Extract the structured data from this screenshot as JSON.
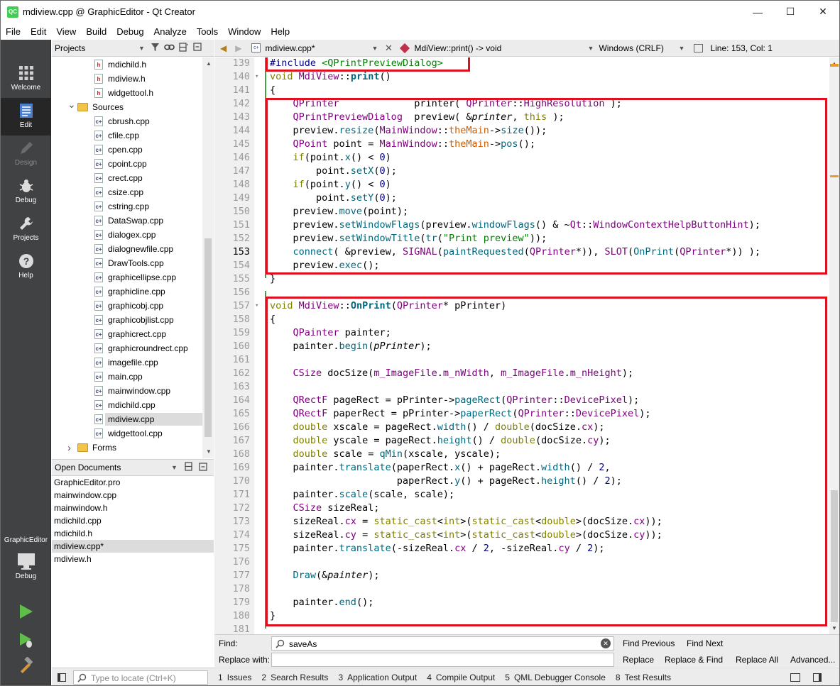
{
  "window": {
    "title": "mdiview.cpp @ GraphicEditor - Qt Creator",
    "logo": "QC",
    "minimize": "—",
    "maximize": "☐",
    "close": "✕"
  },
  "menu": [
    "File",
    "Edit",
    "View",
    "Build",
    "Debug",
    "Analyze",
    "Tools",
    "Window",
    "Help"
  ],
  "modes": [
    {
      "label": "Welcome",
      "icon": "grid-icon"
    },
    {
      "label": "Edit",
      "icon": "edit-icon"
    },
    {
      "label": "Design",
      "icon": "pencil-icon"
    },
    {
      "label": "Debug",
      "icon": "bug-icon"
    },
    {
      "label": "Projects",
      "icon": "wrench-icon"
    },
    {
      "label": "Help",
      "icon": "help-icon"
    }
  ],
  "kit": {
    "project": "GraphicEditor",
    "mode": "Debug"
  },
  "projects_pane": {
    "title": "Projects"
  },
  "tree": [
    {
      "label": "mdichild.h",
      "type": "h"
    },
    {
      "label": "mdiview.h",
      "type": "h"
    },
    {
      "label": "widgettool.h",
      "type": "h"
    },
    {
      "label": "Sources",
      "type": "folder",
      "expanded": true
    },
    {
      "label": "cbrush.cpp",
      "type": "cpp"
    },
    {
      "label": "cfile.cpp",
      "type": "cpp"
    },
    {
      "label": "cpen.cpp",
      "type": "cpp"
    },
    {
      "label": "cpoint.cpp",
      "type": "cpp"
    },
    {
      "label": "crect.cpp",
      "type": "cpp"
    },
    {
      "label": "csize.cpp",
      "type": "cpp"
    },
    {
      "label": "cstring.cpp",
      "type": "cpp"
    },
    {
      "label": "DataSwap.cpp",
      "type": "cpp"
    },
    {
      "label": "dialogex.cpp",
      "type": "cpp"
    },
    {
      "label": "dialognewfile.cpp",
      "type": "cpp"
    },
    {
      "label": "DrawTools.cpp",
      "type": "cpp"
    },
    {
      "label": "graphicellipse.cpp",
      "type": "cpp"
    },
    {
      "label": "graphicline.cpp",
      "type": "cpp"
    },
    {
      "label": "graphicobj.cpp",
      "type": "cpp"
    },
    {
      "label": "graphicobjlist.cpp",
      "type": "cpp"
    },
    {
      "label": "graphicrect.cpp",
      "type": "cpp"
    },
    {
      "label": "graphicroundrect.cpp",
      "type": "cpp"
    },
    {
      "label": "imagefile.cpp",
      "type": "cpp"
    },
    {
      "label": "main.cpp",
      "type": "cpp"
    },
    {
      "label": "mainwindow.cpp",
      "type": "cpp"
    },
    {
      "label": "mdichild.cpp",
      "type": "cpp"
    },
    {
      "label": "mdiview.cpp",
      "type": "cpp",
      "selected": true
    },
    {
      "label": "widgettool.cpp",
      "type": "cpp"
    },
    {
      "label": "Forms",
      "type": "folder",
      "expanded": false
    }
  ],
  "open_documents": {
    "title": "Open Documents",
    "items": [
      "GraphicEditor.pro",
      "mainwindow.cpp",
      "mainwindow.h",
      "mdichild.cpp",
      "mdichild.h",
      "mdiview.cpp*",
      "mdiview.h"
    ],
    "selected": "mdiview.cpp*"
  },
  "editor_toolbar": {
    "file": "mdiview.cpp*",
    "symbol": "MdiView::print() -> void",
    "line_ending": "Windows (CRLF)",
    "position": "Line: 153, Col: 1"
  },
  "code": {
    "current_line": 153,
    "lines": [
      {
        "n": 139,
        "html": "<span class=\"pp\">#include</span> <span class=\"st\">&lt;QPrintPreviewDialog&gt;</span>"
      },
      {
        "n": 140,
        "fold": true,
        "html": "<span class=\"kw\">void</span> <span class=\"ty\">MdiView</span>::<span class=\"fn\" style=\"font-weight:bold\">print</span>()"
      },
      {
        "n": 141,
        "html": "{"
      },
      {
        "n": 142,
        "html": "    <span class=\"ty\">QPrinter</span>             printer( <span class=\"ty\">QPrinter</span>::<span class=\"ty\">HighResolution</span> );"
      },
      {
        "n": 143,
        "html": "    <span class=\"ty\">QPrintPreviewDialog</span>  preview( &amp;<span class=\"it\">printer</span>, <span class=\"kw\">this</span> );"
      },
      {
        "n": 144,
        "html": "    preview.<span class=\"fn\">resize</span>(<span class=\"ty\">MainWindow</span>::<span class=\"mb\">theMain</span>-&gt;<span class=\"fn\">size</span>());"
      },
      {
        "n": 145,
        "html": "    <span class=\"ty\">QPoint</span> point = <span class=\"ty\">MainWindow</span>::<span class=\"mb\">theMain</span>-&gt;<span class=\"fn\">pos</span>();"
      },
      {
        "n": 146,
        "html": "    <span class=\"kw\">if</span>(point.<span class=\"fn\">x</span>() &lt; <span class=\"num\">0</span>)"
      },
      {
        "n": 147,
        "html": "        point.<span class=\"fn\">setX</span>(<span class=\"num\">0</span>);"
      },
      {
        "n": 148,
        "html": "    <span class=\"kw\">if</span>(point.<span class=\"fn\">y</span>() &lt; <span class=\"num\">0</span>)"
      },
      {
        "n": 149,
        "html": "        point.<span class=\"fn\">setY</span>(<span class=\"num\">0</span>);"
      },
      {
        "n": 150,
        "html": "    preview.<span class=\"fn\">move</span>(point);"
      },
      {
        "n": 151,
        "html": "    preview.<span class=\"fn\">setWindowFlags</span>(preview.<span class=\"fn\">windowFlags</span>() &amp; ~<span class=\"ty\">Qt</span>::<span class=\"ty\">WindowContextHelpButtonHint</span>);"
      },
      {
        "n": 152,
        "html": "    preview.<span class=\"fn\">setWindowTitle</span>(<span class=\"fn\">tr</span>(<span class=\"st\">\"Print preview\"</span>));"
      },
      {
        "n": 153,
        "html": "    <span class=\"fn\">connect</span>( &amp;preview, <span class=\"ty\">SIGNAL</span>(<span class=\"fn\">paintRequested</span>(<span class=\"ty\">QPrinter</span>*)), <span class=\"ty\">SLOT</span>(<span class=\"fn\">OnPrint</span>(<span class=\"ty\">QPrinter</span>*)) );"
      },
      {
        "n": 154,
        "html": "    preview.<span class=\"fn\">exec</span>();"
      },
      {
        "n": 155,
        "html": "}"
      },
      {
        "n": 156,
        "html": ""
      },
      {
        "n": 157,
        "fold": true,
        "html": "<span class=\"kw\">void</span> <span class=\"ty\">MdiView</span>::<span class=\"fn\" style=\"font-weight:bold\">OnPrint</span>(<span class=\"ty\">QPrinter</span>* pPrinter)"
      },
      {
        "n": 158,
        "html": "{"
      },
      {
        "n": 159,
        "html": "    <span class=\"ty\">QPainter</span> painter;"
      },
      {
        "n": 160,
        "html": "    painter.<span class=\"fn\">begin</span>(<span class=\"it\">pPrinter</span>);"
      },
      {
        "n": 161,
        "html": ""
      },
      {
        "n": 162,
        "html": "    <span class=\"ty\">CSize</span> docSize(<span class=\"ty\">m_ImageFile</span>.<span class=\"ty\">m_nWidth</span>, <span class=\"ty\">m_ImageFile</span>.<span class=\"ty\">m_nHeight</span>);"
      },
      {
        "n": 163,
        "html": ""
      },
      {
        "n": 164,
        "html": "    <span class=\"ty\">QRectF</span> pageRect = pPrinter-&gt;<span class=\"fn\">pageRect</span>(<span class=\"ty\">QPrinter</span>::<span class=\"ty\">DevicePixel</span>);"
      },
      {
        "n": 165,
        "html": "    <span class=\"ty\">QRectF</span> paperRect = pPrinter-&gt;<span class=\"fn\">paperRect</span>(<span class=\"ty\">QPrinter</span>::<span class=\"ty\">DevicePixel</span>);"
      },
      {
        "n": 166,
        "html": "    <span class=\"kw\">double</span> xscale = pageRect.<span class=\"fn\">width</span>() / <span class=\"kw\">double</span>(docSize.<span class=\"ty\">cx</span>);"
      },
      {
        "n": 167,
        "html": "    <span class=\"kw\">double</span> yscale = pageRect.<span class=\"fn\">height</span>() / <span class=\"kw\">double</span>(docSize.<span class=\"ty\">cy</span>);"
      },
      {
        "n": 168,
        "html": "    <span class=\"kw\">double</span> scale = <span class=\"fn\">qMin</span>(xscale, yscale);"
      },
      {
        "n": 169,
        "html": "    painter.<span class=\"fn\">translate</span>(paperRect.<span class=\"fn\">x</span>() + pageRect.<span class=\"fn\">width</span>() / <span class=\"num\">2</span>,"
      },
      {
        "n": 170,
        "html": "                      paperRect.<span class=\"fn\">y</span>() + pageRect.<span class=\"fn\">height</span>() / <span class=\"num\">2</span>);"
      },
      {
        "n": 171,
        "html": "    painter.<span class=\"fn\">scale</span>(scale, scale);"
      },
      {
        "n": 172,
        "html": "    <span class=\"ty\">CSize</span> sizeReal;"
      },
      {
        "n": 173,
        "html": "    sizeReal.<span class=\"ty\">cx</span> = <span class=\"kw\">static_cast</span>&lt;<span class=\"kw\">int</span>&gt;(<span class=\"kw\">static_cast</span>&lt;<span class=\"kw\">double</span>&gt;(docSize.<span class=\"ty\">cx</span>));"
      },
      {
        "n": 174,
        "html": "    sizeReal.<span class=\"ty\">cy</span> = <span class=\"kw\">static_cast</span>&lt;<span class=\"kw\">int</span>&gt;(<span class=\"kw\">static_cast</span>&lt;<span class=\"kw\">double</span>&gt;(docSize.<span class=\"ty\">cy</span>));"
      },
      {
        "n": 175,
        "html": "    painter.<span class=\"fn\">translate</span>(-sizeReal.<span class=\"ty\">cx</span> / <span class=\"num\">2</span>, -sizeReal.<span class=\"ty\">cy</span> / <span class=\"num\">2</span>);"
      },
      {
        "n": 176,
        "html": ""
      },
      {
        "n": 177,
        "html": "    <span class=\"fn\">Draw</span>(&amp;<span class=\"it\">painter</span>);"
      },
      {
        "n": 178,
        "html": ""
      },
      {
        "n": 179,
        "html": "    painter.<span class=\"fn\">end</span>();"
      },
      {
        "n": 180,
        "html": "}"
      },
      {
        "n": 181,
        "html": ""
      }
    ]
  },
  "find": {
    "find_label": "Find:",
    "replace_label": "Replace with:",
    "find_value": "saveAs",
    "replace_value": "",
    "find_previous": "Find Previous",
    "find_next": "Find Next",
    "replace": "Replace",
    "replace_find": "Replace & Find",
    "replace_all": "Replace All",
    "advanced": "Advanced..."
  },
  "locator": {
    "placeholder": "Type to locate (Ctrl+K)"
  },
  "output_tabs": [
    {
      "n": "1",
      "label": "Issues"
    },
    {
      "n": "2",
      "label": "Search Results"
    },
    {
      "n": "3",
      "label": "Application Output"
    },
    {
      "n": "4",
      "label": "Compile Output"
    },
    {
      "n": "5",
      "label": "QML Debugger Console"
    },
    {
      "n": "8",
      "label": "Test Results"
    }
  ],
  "colors": {
    "highlight_box": "#e0101e",
    "modebar": "#404244",
    "qt_green": "#41cd52"
  }
}
